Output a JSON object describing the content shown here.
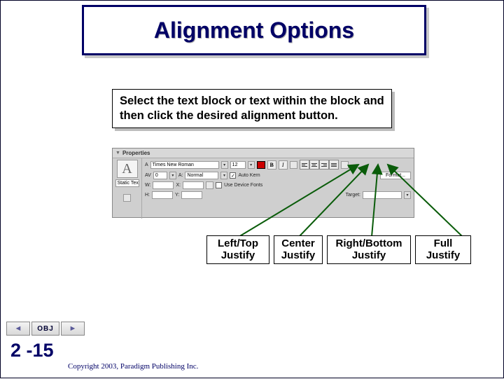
{
  "title": "Alignment Options",
  "instruction": "Select the text block or text within the block and then click the desired alignment button.",
  "panel": {
    "header": "Properties",
    "static_text": "Static Text",
    "font_family": "Times New Roman",
    "font_size": "12",
    "av": "AV",
    "av_val": "0",
    "a_small": "A:",
    "normal": "Normal",
    "autokern": "Auto Kern",
    "format": "Format...",
    "w": "W:",
    "x": "X:",
    "h": "H:",
    "y": "Y:",
    "use_device_fonts": "Use Device Fonts",
    "target": "Target:"
  },
  "callouts": {
    "left": "Left/Top Justify",
    "center": "Center Justify",
    "right": "Right/Bottom Justify",
    "full": "Full Justify"
  },
  "footer": {
    "obj": "OBJ",
    "slide": "2 -15",
    "copyright": "Copyright 2003, Paradigm Publishing Inc."
  }
}
